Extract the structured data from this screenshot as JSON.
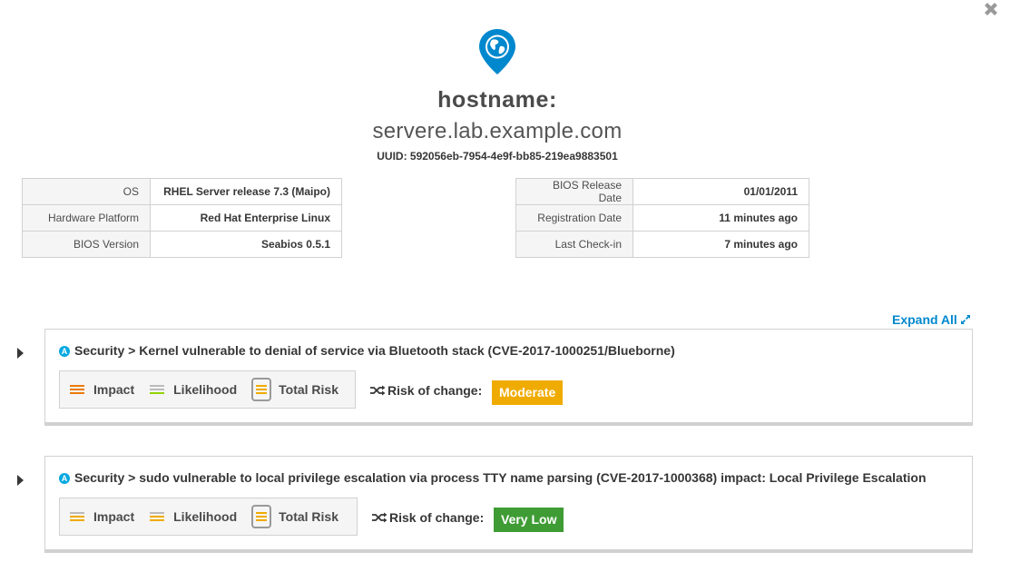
{
  "header": {
    "title": "hostname:",
    "hostname": "servere.lab.example.com",
    "uuid": "UUID: 592056eb-7954-4e9f-bb85-219ea9883501"
  },
  "system_info_left": [
    {
      "label": "OS",
      "value": "RHEL Server release 7.3 (Maipo)"
    },
    {
      "label": "Hardware Platform",
      "value": "Red Hat Enterprise Linux"
    },
    {
      "label": "BIOS Version",
      "value": "Seabios 0.5.1"
    }
  ],
  "system_info_right": [
    {
      "label": "BIOS Release Date",
      "value": "01/01/2011"
    },
    {
      "label": "Registration Date",
      "value": "11 minutes ago"
    },
    {
      "label": "Last Check-in",
      "value": "7 minutes ago"
    }
  ],
  "expand_all_label": "Expand All",
  "rules": [
    {
      "badge": "A",
      "title": "Security > Kernel vulnerable to denial of service via Bluetooth stack (CVE-2017-1000251/Blueborne)",
      "impact_label": "Impact",
      "likelihood_label": "Likelihood",
      "total_risk_label": "Total Risk",
      "risk_of_change_label": "Risk of change:",
      "risk_of_change_value": "Moderate",
      "risk_of_change_color": "#f0ab00",
      "impact_color": "#ec7a08",
      "likelihood_color": "#92d400",
      "total_risk_color": "#f0ab00"
    },
    {
      "badge": "A",
      "title": "Security > sudo vulnerable to local privilege escalation via process TTY name parsing (CVE-2017-1000368) impact: Local Privilege Escalation",
      "impact_label": "Impact",
      "likelihood_label": "Likelihood",
      "total_risk_label": "Total Risk",
      "risk_of_change_label": "Risk of change:",
      "risk_of_change_value": "Very Low",
      "risk_of_change_color": "#3f9c35",
      "impact_color": "#f0ab00",
      "likelihood_color": "#f0ab00",
      "total_risk_color": "#f0ab00"
    }
  ],
  "colors": {
    "accent": "#0088ce",
    "pin": "#0088ce"
  },
  "icons": {
    "close": "close-icon",
    "pin": "map-pin-globe-icon",
    "expand": "expand-arrows-icon",
    "shuffle": "shuffle-icon"
  }
}
